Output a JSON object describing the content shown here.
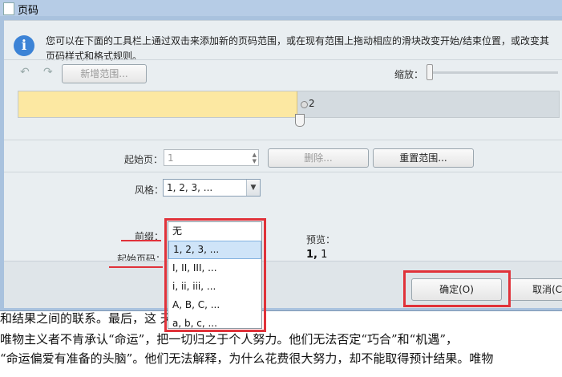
{
  "window": {
    "title": "页码"
  },
  "info": {
    "text": "您可以在下面的工具栏上通过双击来添加新的页码范围，或在现有范围上拖动相应的滑块改变开始/结束位置，或改变其页码样式和格式规则。"
  },
  "toolbar": {
    "undo_icon": "undo-icon",
    "redo_icon": "redo-icon",
    "add_range_label": "新增范围...",
    "zoom_label": "缩放："
  },
  "range": {
    "end_label": "2",
    "fill_color": "#fce8a2"
  },
  "start_page": {
    "label": "起始页：",
    "value": "1",
    "delete_label": "删除...",
    "reset_label": "重置范围..."
  },
  "style": {
    "label": "风格：",
    "selected": "1, 2, 3, ...",
    "options": [
      "无",
      "1, 2, 3, ...",
      "I, II, III, ...",
      "i, ii, iii, ...",
      "A, B, C, ...",
      "a, b, c, ..."
    ],
    "selected_index": 1
  },
  "prefix": {
    "label": "前缀："
  },
  "start_number": {
    "label": "起始页码："
  },
  "preview": {
    "label": "预览：",
    "value_bold": "1,",
    "value_rest": " 1"
  },
  "buttons": {
    "ok_label": "确定(O)",
    "cancel_label": "取消(C)"
  },
  "document": {
    "lines": [
      "和结果之间的联系。最后，这          天意或者机遇。",
      "    唯物主义者不肯承认“命运”，把一切归之于个人努力。他们无法否定“巧合”和“机遇”，",
      "“命运偏爱有准备的头脑”。他们无法解释，为什么花费很大努力，却不能取得预计结果。唯物"
    ]
  },
  "annotation_color": "#e0323a"
}
